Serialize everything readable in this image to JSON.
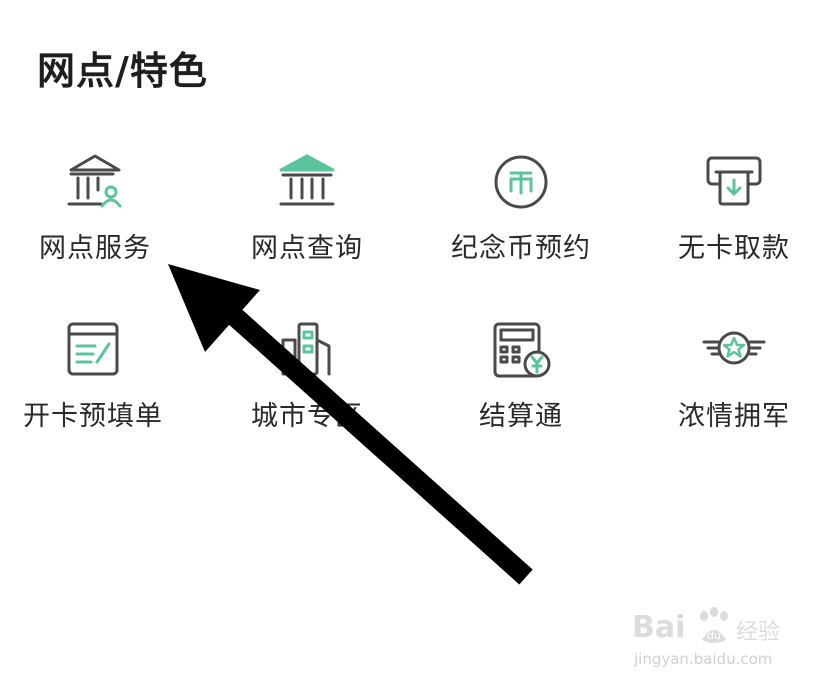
{
  "section": {
    "title": "网点/特色"
  },
  "colors": {
    "accent": "#5cc49c",
    "icon_stroke": "#4a4a4a",
    "arrow": "#000000"
  },
  "items": [
    {
      "label": "网点服务",
      "icon": "bank-person-icon"
    },
    {
      "label": "网点查询",
      "icon": "bank-building-icon"
    },
    {
      "label": "纪念币预约",
      "icon": "coin-icon"
    },
    {
      "label": "无卡取款",
      "icon": "atm-withdraw-icon"
    },
    {
      "label": "开卡预填单",
      "icon": "form-edit-icon"
    },
    {
      "label": "城市专区",
      "icon": "city-buildings-icon"
    },
    {
      "label": "结算通",
      "icon": "calculator-yen-icon"
    },
    {
      "label": "浓情拥军",
      "icon": "star-badge-icon"
    }
  ],
  "watermark": {
    "brand": "Bai",
    "brand_suffix": "du",
    "product": "经验",
    "url": "jingyan.baidu.com"
  }
}
